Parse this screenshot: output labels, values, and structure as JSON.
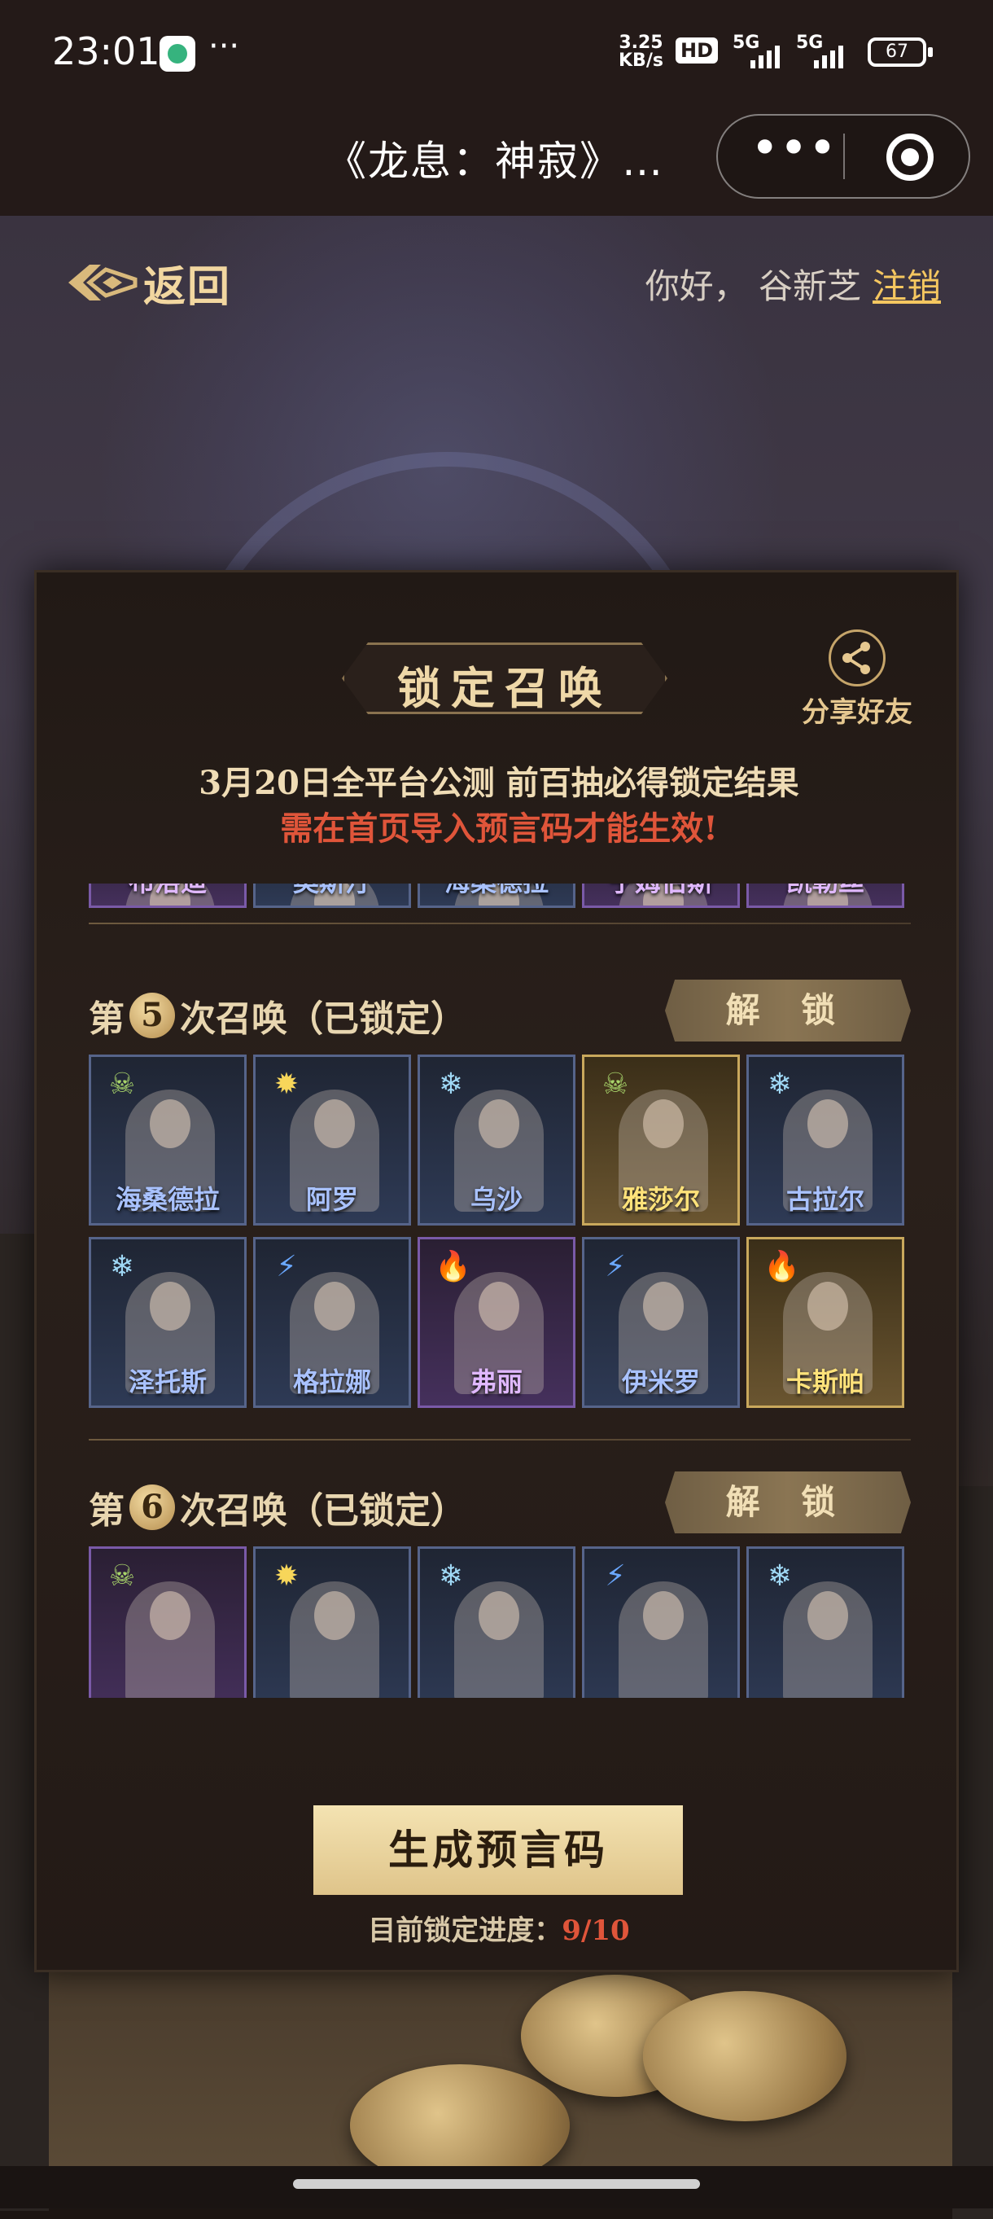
{
  "status_bar": {
    "time": "23:01",
    "more": "···",
    "net_speed": "3.25",
    "net_unit": "KB/s",
    "hd": "HD",
    "sim1": "5G",
    "sim2": "5G",
    "battery": "67"
  },
  "title_bar": {
    "title": "《龙息：神寂》…",
    "more_icon": "more-dots-icon",
    "close_icon": "target-icon"
  },
  "header": {
    "back_label": "返回",
    "greeting": "你好，  谷新芝",
    "logout": "注销"
  },
  "panel": {
    "title": "锁定召唤",
    "share_label": "分享好友",
    "notice_line1": "3月20日全平台公测  前百抽必得锁定结果",
    "notice_line2": "需在首页导入预言码才能生效!",
    "partial_row": [
      {
        "name": "布洛迪",
        "rarity": "purple"
      },
      {
        "name": "奥斯汀",
        "rarity": "blue"
      },
      {
        "name": "海桑德拉",
        "rarity": "blue"
      },
      {
        "name": "宁姆伯斯",
        "rarity": "purple"
      },
      {
        "name": "凯勒丝",
        "rarity": "purple"
      }
    ],
    "sections": [
      {
        "prefix": "第",
        "number": "5",
        "suffix": "次召唤（已锁定）",
        "unlock_label": "解 锁",
        "heroes": [
          {
            "name": "海桑德拉",
            "element": "skull",
            "rarity": "blue"
          },
          {
            "name": "阿罗",
            "element": "sun",
            "rarity": "blue"
          },
          {
            "name": "乌沙",
            "element": "frost",
            "rarity": "blue"
          },
          {
            "name": "雅莎尔",
            "element": "skull",
            "rarity": "gold"
          },
          {
            "name": "古拉尔",
            "element": "frost",
            "rarity": "blue"
          },
          {
            "name": "泽托斯",
            "element": "frost",
            "rarity": "blue"
          },
          {
            "name": "格拉娜",
            "element": "bolt",
            "rarity": "blue"
          },
          {
            "name": "弗丽",
            "element": "fire",
            "rarity": "purple"
          },
          {
            "name": "伊米罗",
            "element": "bolt",
            "rarity": "blue"
          },
          {
            "name": "卡斯帕",
            "element": "fire",
            "rarity": "gold"
          }
        ]
      },
      {
        "prefix": "第",
        "number": "6",
        "suffix": "次召唤（已锁定）",
        "unlock_label": "解 锁",
        "heroes": [
          {
            "name": "",
            "element": "skull",
            "rarity": "purple"
          },
          {
            "name": "",
            "element": "sun",
            "rarity": "blue"
          },
          {
            "name": "",
            "element": "frost",
            "rarity": "blue"
          },
          {
            "name": "",
            "element": "bolt",
            "rarity": "blue"
          },
          {
            "name": "",
            "element": "frost",
            "rarity": "blue"
          }
        ]
      }
    ],
    "generate_button": "生成预言码",
    "progress_label": "目前锁定进度：",
    "progress_value": "9/10"
  },
  "colors": {
    "accent_gold": "#f5c760",
    "warning_red": "#e0553a",
    "blue_name": "#a9c2ff",
    "purple_name": "#e0b8ff",
    "gold_name": "#ffe27a"
  }
}
